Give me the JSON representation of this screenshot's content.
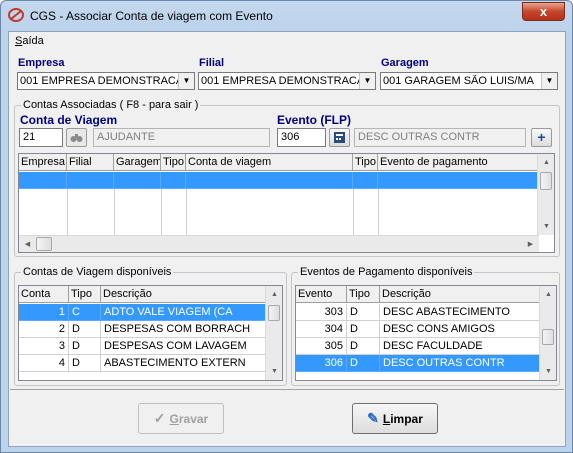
{
  "window": {
    "title": "CGS - Associar Conta de viagem com Evento",
    "close_glyph": "x"
  },
  "menu": {
    "saida_prefix": "S",
    "saida_rest": "aída"
  },
  "filters": {
    "empresa": {
      "label": "Empresa",
      "value": "001 EMPRESA DEMONSTRACA"
    },
    "filial": {
      "label": "Filial",
      "value": "001 EMPRESA DEMONSTRACA"
    },
    "garagem": {
      "label": "Garagem",
      "value": "001 GARAGEM SÃO LUIS/MA"
    }
  },
  "assoc_group": {
    "title": "Contas Associadas ( F8 - para sair )",
    "conta_label": "Conta de Viagem",
    "conta_code": "21",
    "conta_desc": "AJUDANTE",
    "evento_label": "Evento (FLP)",
    "evento_code": "306",
    "evento_desc": "DESC OUTRAS CONTR",
    "headers": [
      "Empresa",
      "Filial",
      "Garagem",
      "Tipo",
      "Conta de viagem",
      "Tipo",
      "Evento de pagamento"
    ]
  },
  "contas_group": {
    "title": "Contas de Viagem disponíveis",
    "headers": [
      "Conta",
      "Tipo",
      "Descrição"
    ],
    "rows": [
      {
        "conta": "1",
        "tipo": "C",
        "descricao": "ADTO VALE VIAGEM (CA",
        "selected": true
      },
      {
        "conta": "2",
        "tipo": "D",
        "descricao": "DESPESAS COM BORRACH",
        "selected": false
      },
      {
        "conta": "3",
        "tipo": "D",
        "descricao": "DESPESAS COM LAVAGEM",
        "selected": false
      },
      {
        "conta": "4",
        "tipo": "D",
        "descricao": "ABASTECIMENTO EXTERN",
        "selected": false
      }
    ]
  },
  "eventos_group": {
    "title": "Eventos de Pagamento disponíveis",
    "headers": [
      "Evento",
      "Tipo",
      "Descrição"
    ],
    "rows": [
      {
        "evento": "303",
        "tipo": "D",
        "descricao": "DESC ABASTECIMENTO",
        "selected": false
      },
      {
        "evento": "304",
        "tipo": "D",
        "descricao": "DESC CONS AMIGOS",
        "selected": false
      },
      {
        "evento": "305",
        "tipo": "D",
        "descricao": "DESC FACULDADE",
        "selected": false
      },
      {
        "evento": "306",
        "tipo": "D",
        "descricao": "DESC OUTRAS CONTR",
        "selected": true
      }
    ]
  },
  "buttons": {
    "gravar_prefix": "G",
    "gravar_rest": "ravar",
    "limpar_prefix": "L",
    "limpar_rest": "impar"
  },
  "icons": {
    "app": "cgs-logo-icon",
    "search": "binoculars-icon",
    "lookup": "calculator-icon",
    "add": "plus-icon",
    "gravar": "checkmark-icon",
    "limpar": "eraser-icon"
  },
  "colors": {
    "selection": "#3399ff",
    "label_blue": "#000080"
  }
}
